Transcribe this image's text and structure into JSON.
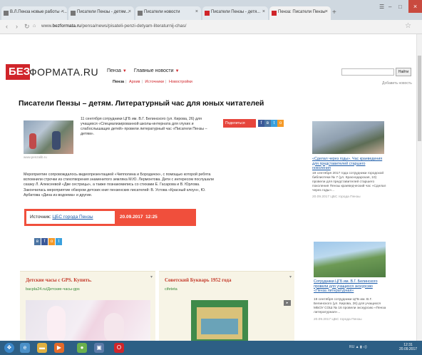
{
  "browser": {
    "tabs": [
      {
        "label": "В.Л.Пенза новые работы - ..."
      },
      {
        "label": "Писатели Пензы - детям..."
      },
      {
        "label": "Писатели новости"
      },
      {
        "label": "Писатели Пензы - детя..."
      },
      {
        "label": "Пенза: Писатели Пензы"
      }
    ],
    "url_prefix": "www.",
    "url_domain": "bezformata.ru",
    "url_path": "/pensa/news/pisateli-penzi-detyam-literaturnij-chas/"
  },
  "site": {
    "logo_red": "БЕЗ",
    "logo_text": "ФОРМАТА.RU",
    "nav": [
      {
        "label": "Пенза"
      },
      {
        "label": "Главные новости"
      }
    ],
    "subnav": [
      {
        "label": "Пенза"
      },
      {
        "label": "Архив"
      },
      {
        "label": "Источники"
      },
      {
        "label": "Новостройки"
      }
    ],
    "search_button": "Найти",
    "add_news": "Добавить новость"
  },
  "article": {
    "title": "Писатели Пензы – детям. Литературный час для юных читателей",
    "photo_caption": "www.penzalib.ru",
    "intro": "11 сентября сотрудники ЦГБ им. В.Г. Белинского (ул. Кирова, 26) для учащихся «Специализированной школы-интерната для глухих и слабослышащих детей» провели литературный час «Писатели Пензы – детям».",
    "para2": "Мероприятие сопровождалось видеопрезентацией «Чипполина и Бородачок», с помощью которой ребята вспомнили строчки из стихотворения знаменитого земляка М.Ю. Лермонтова. Дети с интересом послушали сказку Л. Алексеевой «Две сестрицы», а также познакомились со стихами Е. Гасарова и В. Юрлова.",
    "para3": "Закончилась мероприятие обзором детских книг пензенских писателей: В. Устова «Красный клоун», Ю. Арбатова «Дина из водоема» и другие.",
    "share_label": "Поделиться",
    "source_label": "Источник:",
    "source_link": "ЦБС города Пензы",
    "date": "20.09.2017",
    "time": "12:25"
  },
  "sidebar": [
    {
      "link": "«Сделал через годы». Час краеведения для представителей старшего поколения",
      "text": "19 сентября 2017 года сотрудники городской библиотеки № 7 (ул. Краснодарская, 10) провели для представителей старшего поколения Пензы краеведческий час «Сделал через годы»...",
      "meta": "20.09.2017 ЦБС города Пензы"
    },
    {
      "link": "Сотрудники ЦГБ им. В.Г. Белинского провели для учащихся экскурсию «Пенза литературная»",
      "text": "19 сентября сотрудники ЦГБ им. В.Г. Белинского (ул. Кирова, 26) для учащихся МБОУ СОШ № 16 провели экскурсию «Пенза литературная»...",
      "meta": "20.09.2017 ЦБС города Пензы"
    }
  ],
  "ads": [
    {
      "title": "Детские часы с GPS. Купить.",
      "source": "bacpla24.ru/Детские-часы-gps"
    },
    {
      "title": "Советский Букварь 1952 года",
      "source": "cifeteta"
    }
  ],
  "taskbar": {
    "tray": "RU",
    "time": "12:31",
    "date": "20.09.2017"
  },
  "colors": {
    "brand": "#d0252a",
    "source_bar": "#f04f3c",
    "taskbar": "#2d5f85"
  }
}
